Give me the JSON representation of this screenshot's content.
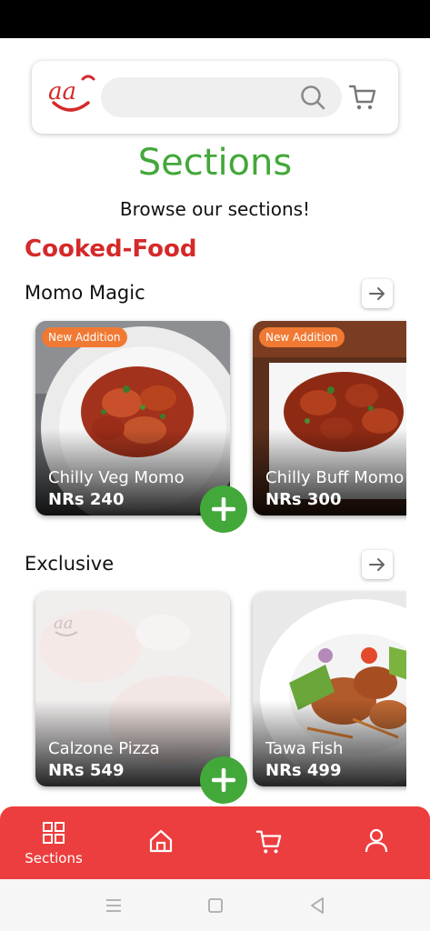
{
  "header": {
    "logo_text": "aa",
    "search_placeholder": "",
    "search_icon": "search-icon",
    "cart_icon": "cart-icon"
  },
  "page": {
    "title": "Sections",
    "subtitle": "Browse our sections!"
  },
  "category": {
    "name": "Cooked-Food"
  },
  "sections": [
    {
      "label": "Momo Magic",
      "items": [
        {
          "badge": "New Addition",
          "name": "Chilly Veg Momo",
          "price": "NRs 240"
        },
        {
          "badge": "New Addition",
          "name": "Chilly Buff Momo",
          "price": "NRs 300"
        }
      ]
    },
    {
      "label": "Exclusive",
      "items": [
        {
          "badge": "",
          "name": "Calzone Pizza",
          "price": "NRs 549"
        },
        {
          "badge": "",
          "name": "Tawa Fish",
          "price": "NRs 499"
        }
      ]
    }
  ],
  "bottom_nav": {
    "sections_label": "Sections",
    "icons": [
      "grid-icon",
      "home-icon",
      "cart-icon",
      "user-icon"
    ]
  },
  "colors": {
    "accent_green": "#43a83a",
    "brand_red": "#ec3e3e",
    "category_red": "#d42a2a",
    "badge_orange": "#f07a33"
  }
}
